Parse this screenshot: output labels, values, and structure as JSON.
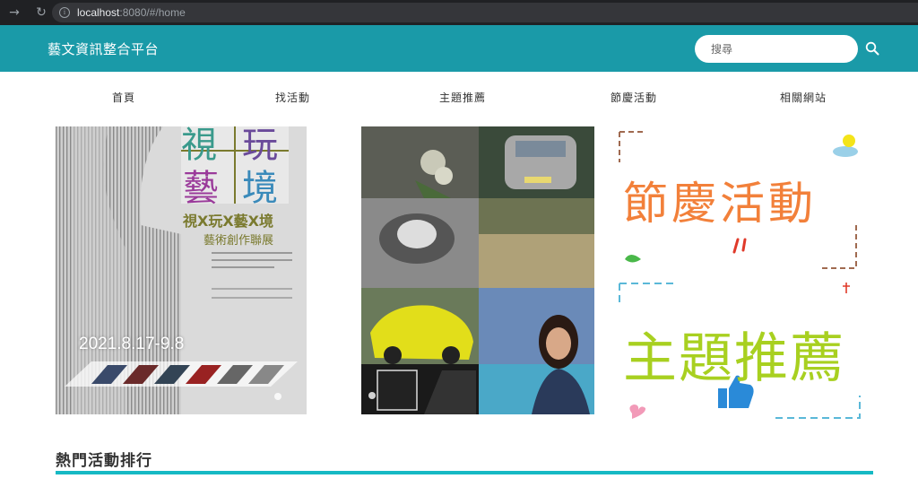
{
  "browser": {
    "url_host": "localhost",
    "url_rest": ":8080/#/home",
    "back_icon": "back-arrow-icon",
    "reload_icon": "reload-icon",
    "info_icon": "info-icon"
  },
  "header": {
    "brand": "藝文資訊整合平台",
    "search_placeholder": "搜尋",
    "accent_color": "#1a9aa8"
  },
  "nav": {
    "items": [
      {
        "label": "首頁"
      },
      {
        "label": "找活動"
      },
      {
        "label": "主題推薦"
      },
      {
        "label": "節慶活動"
      },
      {
        "label": "相關網站"
      }
    ]
  },
  "banners": {
    "poster": {
      "big_chars": [
        "視",
        "玩",
        "藝",
        "境"
      ],
      "title": "視X玩X藝X境",
      "subtitle": "藝術創作聯展",
      "date": "2021.8.17-9.8"
    },
    "festival": {
      "line1": "節慶活動",
      "line2": "主題推薦"
    }
  },
  "hot": {
    "title": "熱門活動排行",
    "rule_color": "#16b9c4"
  }
}
